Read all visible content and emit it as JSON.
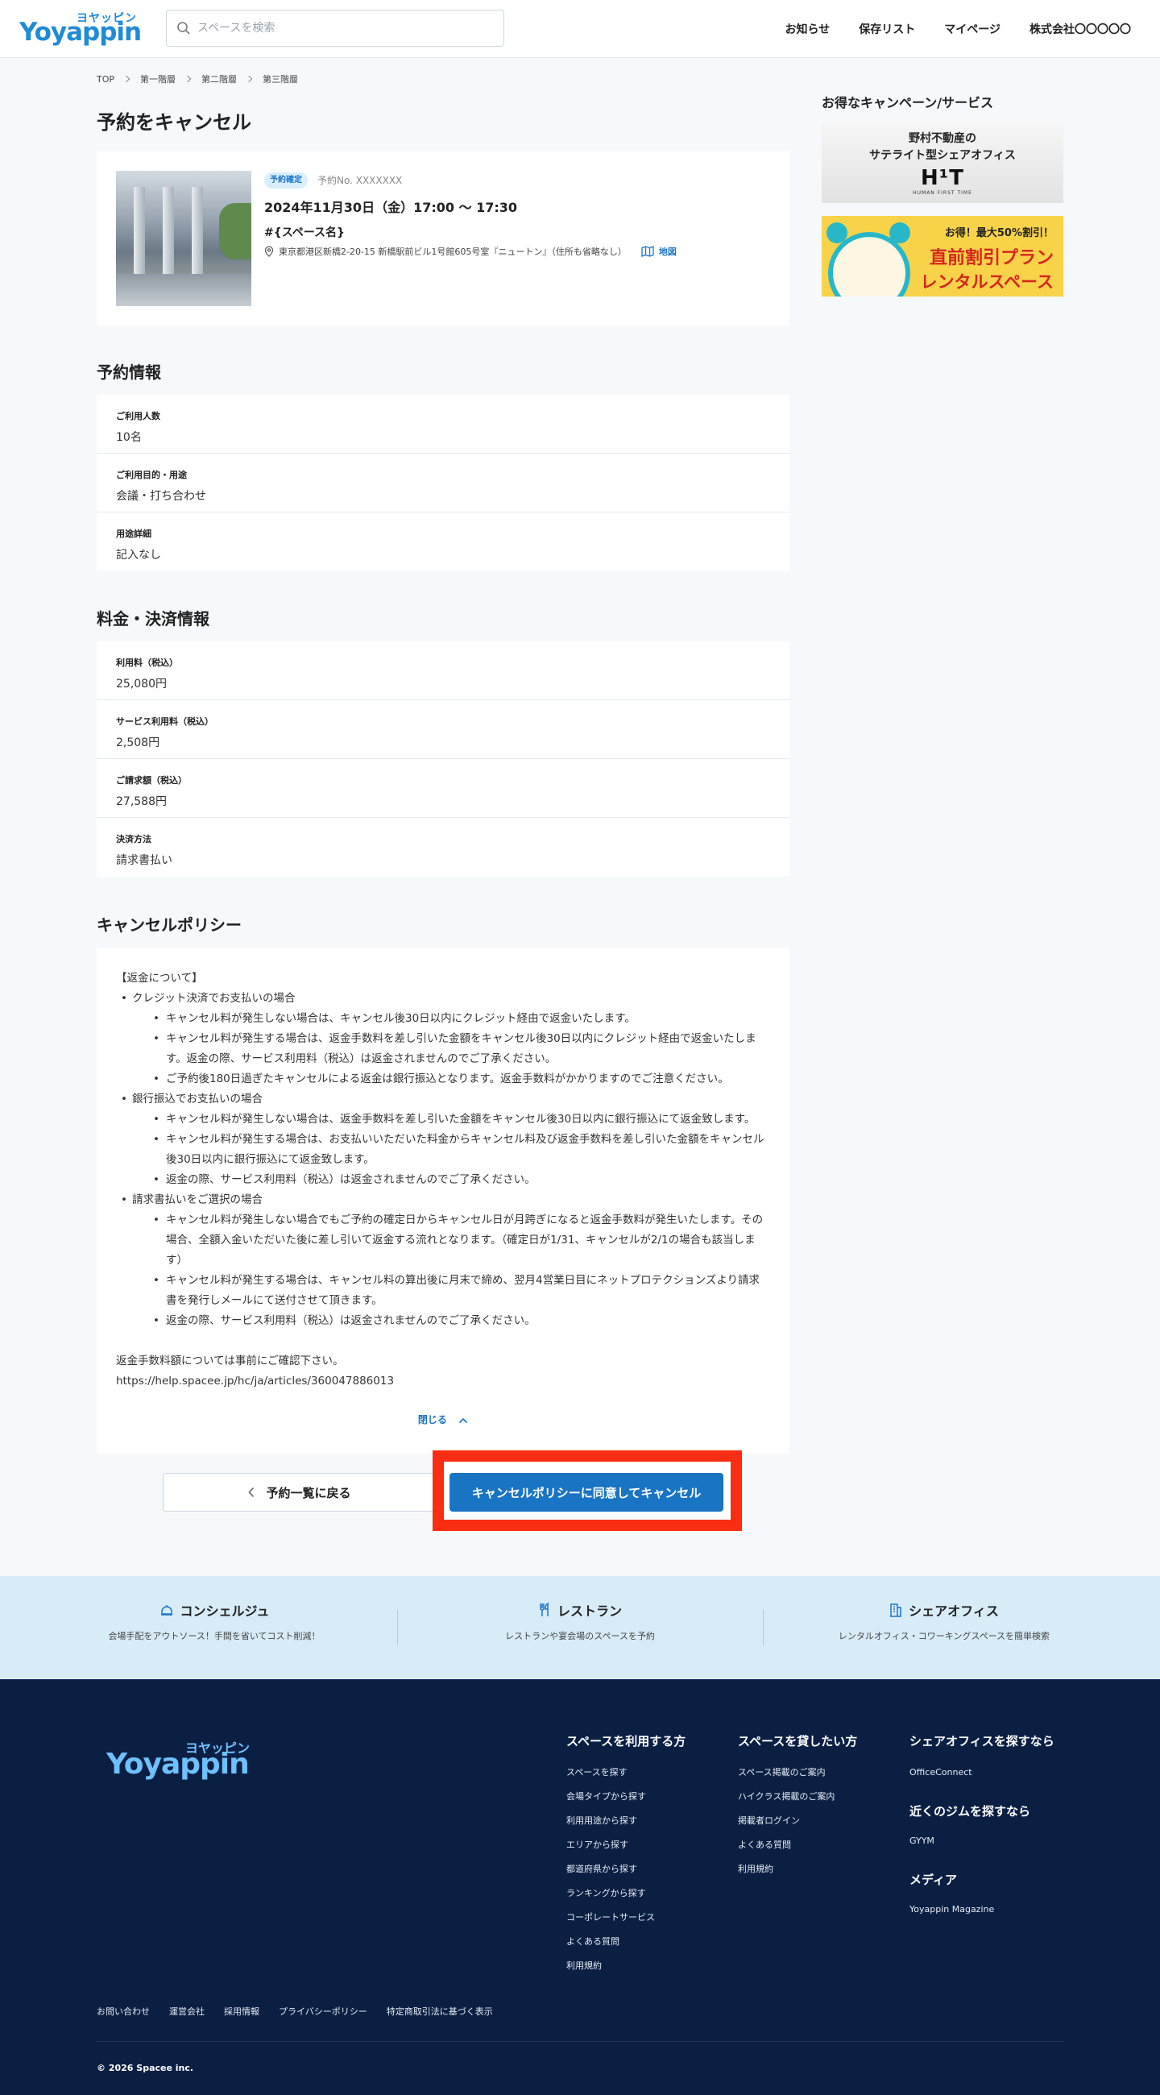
{
  "header": {
    "logo_kana": "ヨヤッピン",
    "logo_text": "Yoyappin",
    "search_placeholder": "スペースを検索",
    "nav": [
      "お知らせ",
      "保存リスト",
      "マイページ",
      "株式会社〇〇〇〇〇"
    ]
  },
  "breadcrumb": [
    "TOP",
    "第一階層",
    "第二階層",
    "第三階層"
  ],
  "page_title": "予約をキャンセル",
  "reservation": {
    "status_badge": "予約確定",
    "reservation_no": "予約No. XXXXXXX",
    "datetime": "2024年11月30日（金）17:00 〜 17:30",
    "space_name": "#{スペース名}",
    "address": "東京都港区新橋2-20-15 新橋駅前ビル1号館605号室『ニュートン』（住所も省略なし）",
    "map_label": "地図"
  },
  "reservation_info": {
    "title": "予約情報",
    "rows": [
      {
        "label": "ご利用人数",
        "value": "10名"
      },
      {
        "label": "ご利用目的・用途",
        "value": "会議・打ち合わせ"
      },
      {
        "label": "用途詳細",
        "value": "記入なし"
      }
    ]
  },
  "payment_info": {
    "title": "料金・決済情報",
    "rows": [
      {
        "label": "利用料（税込）",
        "value": "25,080円"
      },
      {
        "label": "サービス利用料（税込）",
        "value": "2,508円"
      },
      {
        "label": "ご請求額（税込）",
        "value": "27,588円"
      },
      {
        "label": "決済方法",
        "value": "請求書払い"
      }
    ]
  },
  "cancel_policy": {
    "title": "キャンセルポリシー",
    "heading": "【返金について】",
    "sections": [
      {
        "title": "クレジット決済でお支払いの場合",
        "items": [
          "キャンセル料が発生しない場合は、キャンセル後30日以内にクレジット経由で返金いたします。",
          "キャンセル料が発生する場合は、返金手数料を差し引いた金額をキャンセル後30日以内にクレジット経由で返金いたします。返金の際、サービス利用料（税込）は返金されませんのでご了承ください。",
          "ご予約後180日過ぎたキャンセルによる返金は銀行振込となります。返金手数料がかかりますのでご注意ください。"
        ]
      },
      {
        "title": "銀行振込でお支払いの場合",
        "items": [
          "キャンセル料が発生しない場合は、返金手数料を差し引いた金額をキャンセル後30日以内に銀行振込にて返金致します。",
          "キャンセル料が発生する場合は、お支払いいただいた料金からキャンセル料及び返金手数料を差し引いた金額をキャンセル後30日以内に銀行振込にて返金致します。",
          "返金の際、サービス利用料（税込）は返金されませんのでご了承ください。"
        ]
      },
      {
        "title": "請求書払いをご選択の場合",
        "items": [
          "キャンセル料が発生しない場合でもご予約の確定日からキャンセル日が月跨ぎになると返金手数料が発生いたします。その場合、全額入金いただいた後に差し引いて返金する流れとなります。（確定日が1/31、キャンセルが2/1の場合も該当します）",
          "キャンセル料が発生する場合は、キャンセル料の算出後に月末で締め、翌月4営業日目にネットプロテクションズより請求書を発行しメールにて送付させて頂きます。",
          "返金の際、サービス利用料（税込）は返金されませんのでご了承ください。"
        ]
      }
    ],
    "note": "返金手数料額については事前にご確認下さい。",
    "note_url": "https://help.spacee.jp/hc/ja/articles/360047886013",
    "close_label": "閉じる"
  },
  "actions": {
    "back_label": "予約一覧に戻る",
    "cancel_label": "キャンセルポリシーに同意してキャンセル",
    "highlight_color": "#f92d12"
  },
  "aside": {
    "title": "お得なキャンペーン/サービス",
    "banner1": {
      "line1": "野村不動産の",
      "line2": "サテライト型シェアオフィス",
      "brand": "H¹T",
      "sub": "HUMAN FIRST TIME"
    },
    "banner2": {
      "line1": "お得！最大50%割引！",
      "line2": "直前割引プラン",
      "line3": "レンタルスペース"
    }
  },
  "services": [
    {
      "icon": "concierge-icon",
      "title": "コンシェルジュ",
      "sub": "会場手配をアウトソース！手間を省いてコスト削減！"
    },
    {
      "icon": "restaurant-icon",
      "title": "レストラン",
      "sub": "レストランや宴会場のスペースを予約"
    },
    {
      "icon": "office-icon",
      "title": "シェアオフィス",
      "sub": "レンタルオフィス・コワーキングスペースを簡単検索"
    }
  ],
  "footer": {
    "logo_kana": "ヨヤッピン",
    "logo_text": "Yoyappin",
    "col1": {
      "title": "スペースを利用する方",
      "items": [
        "スペースを探す",
        "会場タイプから探す",
        "利用用途から探す",
        "エリアから探す",
        "都道府県から探す",
        "ランキングから探す",
        "コーポレートサービス",
        "よくある質問",
        "利用規約"
      ]
    },
    "col2": {
      "title": "スペースを貸したい方",
      "items": [
        "スペース掲載のご案内",
        "ハイクラス掲載のご案内",
        "掲載者ログイン",
        "よくある質問",
        "利用規約"
      ]
    },
    "col3": [
      {
        "title": "シェアオフィスを探すなら",
        "items": [
          "OfficeConnect"
        ]
      },
      {
        "title": "近くのジムを探すなら",
        "items": [
          "GYYM"
        ]
      },
      {
        "title": "メディア",
        "items": [
          "Yoyappin Magazine"
        ]
      }
    ],
    "bottom_links": [
      "お問い合わせ",
      "運営会社",
      "採用情報",
      "プライバシーポリシー",
      "特定商取引法に基づく表示"
    ],
    "copyright": "© 2026 Spacee inc."
  },
  "colors": {
    "accent": "#1a74c4",
    "footer_bg": "#0b1f43",
    "service_bg": "#d8ecf8"
  }
}
